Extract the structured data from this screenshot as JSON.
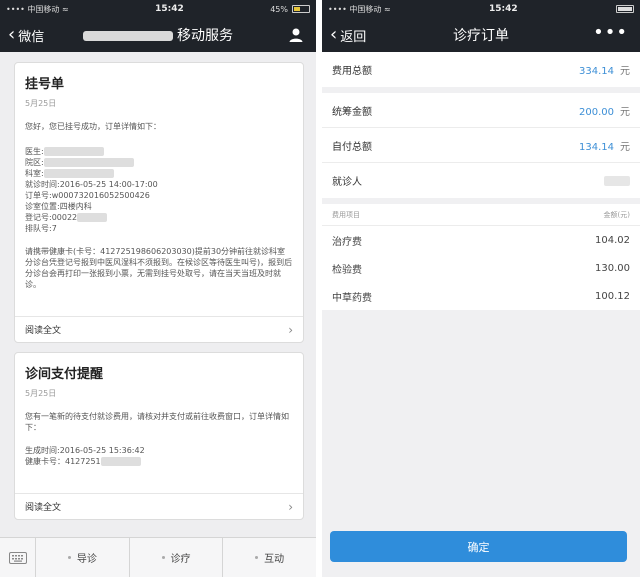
{
  "left": {
    "statusbar": {
      "carrier": "•••• 中国移动 ≈",
      "time": "15:42",
      "battery_text": "45%",
      "battery_level": 0.45
    },
    "navbar": {
      "back_label": "微信",
      "title": "移动服务"
    },
    "card1": {
      "title": "挂号单",
      "date": "5月25日",
      "intro": "您好，您已挂号成功，订单详情如下：",
      "lines": [
        "医生:",
        "院区:",
        "科室:",
        "就诊时间:2016-05-25 14:00-17:00",
        "订单号:w000732016052500426",
        "诊室位置:四楼内科",
        "登记号:00022",
        "排队号:7"
      ],
      "notice": "请携带健康卡(卡号：412725198606203030)提前30分钟前往就诊科室分诊台凭登记号报到中医风湿科不须报到。在候诊区等待医生叫号)，报到后分诊台会再打印一张报到小票，无需到挂号处取号，请在当天当班及时就诊。",
      "read_more": "阅读全文"
    },
    "card2": {
      "title": "诊间支付提醒",
      "date": "5月25日",
      "body": "您有一笔新的待支付就诊费用，请核对并支付或前往收费窗口，订单详情如下：",
      "lines": [
        "生成时间:2016-05-25 15:36:42",
        "健康卡号：4127251"
      ],
      "read_more": "阅读全文"
    },
    "menu": [
      "导诊",
      "诊疗",
      "互动"
    ]
  },
  "right": {
    "statusbar": {
      "carrier": "•••• 中国移动 ≈",
      "time": "15:42"
    },
    "navbar": {
      "back_label": "返回",
      "title": "诊疗订单",
      "more": "•••"
    },
    "total": {
      "label": "费用总额",
      "value": "334.14",
      "unit": "元"
    },
    "payments": [
      {
        "label": "统筹金额",
        "value": "200.00",
        "unit": "元"
      },
      {
        "label": "自付总额",
        "value": "134.14",
        "unit": "元"
      }
    ],
    "patient": {
      "label": "就诊人"
    },
    "table_header": {
      "left": "费用项目",
      "right": "金额(元)"
    },
    "items": [
      {
        "name": "治疗费",
        "amount": "104.02"
      },
      {
        "name": "检验费",
        "amount": "130.00"
      },
      {
        "name": "中草药费",
        "amount": "100.12"
      }
    ],
    "confirm_label": "确定"
  },
  "colors": {
    "navbar": "#1f2329",
    "accent": "#2f8ddb",
    "amount": "#3d8fd6"
  }
}
